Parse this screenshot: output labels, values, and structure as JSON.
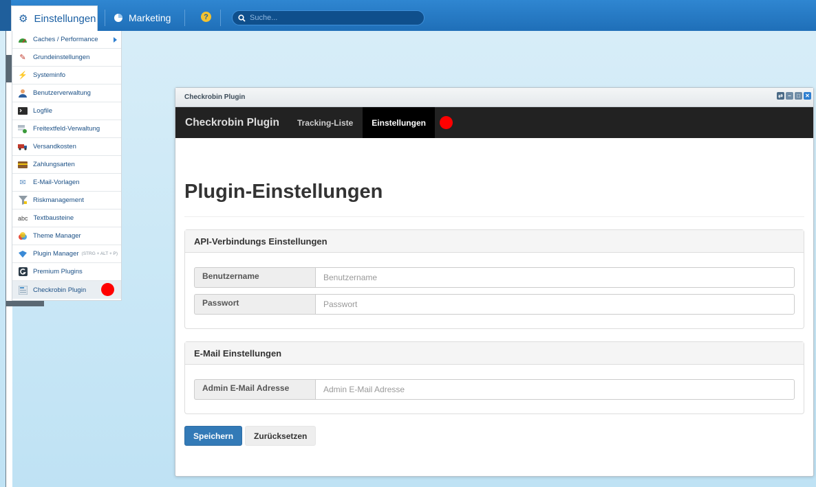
{
  "topbar": {
    "active_tab": "Einstellungen",
    "marketing_tab": "Marketing",
    "help_glyph": "?",
    "search_placeholder": "Suche..."
  },
  "menu": {
    "items": [
      {
        "label": "Caches / Performance",
        "icon": "speedometer-icon",
        "has_submenu": true
      },
      {
        "label": "Grundeinstellungen",
        "icon": "wrench-icon"
      },
      {
        "label": "Systeminfo",
        "icon": "lightning-icon"
      },
      {
        "label": "Benutzerverwaltung",
        "icon": "user-icon"
      },
      {
        "label": "Logfile",
        "icon": "terminal-icon"
      },
      {
        "label": "Freitextfeld-Verwaltung",
        "icon": "field-add-icon"
      },
      {
        "label": "Versandkosten",
        "icon": "truck-icon"
      },
      {
        "label": "Zahlungsarten",
        "icon": "credit-card-icon"
      },
      {
        "label": "E-Mail-Vorlagen",
        "icon": "mail-template-icon"
      },
      {
        "label": "Riskmanagement",
        "icon": "funnel-icon"
      },
      {
        "label": "Textbausteine",
        "icon": "abc-icon"
      },
      {
        "label": "Theme Manager",
        "icon": "theme-icon"
      },
      {
        "label": "Plugin Manager",
        "hint": "(STRG + ALT + P)",
        "icon": "puzzle-icon"
      },
      {
        "label": "Premium Plugins",
        "icon": "premium-logo-icon"
      },
      {
        "label": "Checkrobin Plugin",
        "icon": "plugin-window-icon",
        "active": true
      }
    ]
  },
  "window": {
    "title": "Checkrobin Plugin",
    "navbar": {
      "brand": "Checkrobin Plugin",
      "links": [
        "Tracking-Liste",
        "Einstellungen"
      ]
    },
    "page_title": "Plugin-Einstellungen",
    "api_panel": {
      "heading": "API-Verbindungs Einstellungen",
      "username_label": "Benutzername",
      "username_placeholder": "Benutzername",
      "password_label": "Passwort",
      "password_placeholder": "Passwort"
    },
    "email_panel": {
      "heading": "E-Mail Einstellungen",
      "admin_email_label": "Admin E-Mail Adresse",
      "admin_email_placeholder": "Admin E-Mail Adresse"
    },
    "buttons": {
      "save": "Speichern",
      "reset": "Zurücksetzen"
    }
  },
  "colors": {
    "topbar": "#1f6fb8",
    "navbar": "#222222",
    "primary_button": "#337ab7",
    "annotation_dot": "#ff0000"
  }
}
